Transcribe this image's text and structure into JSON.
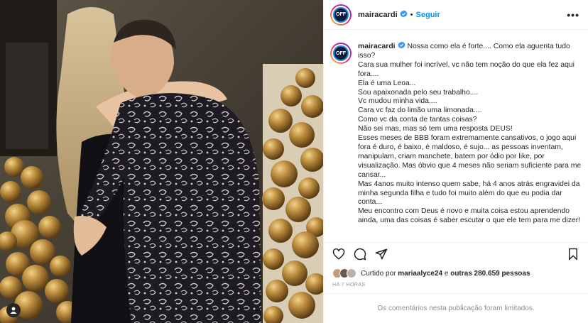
{
  "header": {
    "username": "mairacardi",
    "separator": "•",
    "follow_label": "Seguir",
    "more_label": "•••",
    "avatar_text": "OFF"
  },
  "caption": {
    "username": "mairacardi",
    "lines": [
      "Nossa como ela é forte.... Como ela aguenta tudo",
      "isso?",
      "Cara sua mulher foi incrível, vc não tem noção do que ela fez aqui",
      "fora....",
      "Ela é uma Leoa...",
      "Sou apaixonada pelo seu trabalho....",
      "Vc mudou minha vida....",
      "Cara vc faz do limão uma limonada....",
      "Como vc da conta de tantas coisas?",
      "Não sei mas, mas só tem uma resposta DEUS!",
      "Esses meses de BBB foram extremamente cansativos, o jogo aqui",
      "fora é duro, é baixo, é maldoso, é sujo... as pessoas inventam,",
      "manipulam, criam manchete, batem por ódio por like, por",
      "visualização. Mas óbvio que 4 meses não seriam suficiente para me",
      "cansar...",
      "Mas 4anos muito intenso quem sabe, há 4 anos atrás engravidei da",
      "minha segunda filha e tudo foi muito além do que eu podia dar",
      "conta...",
      "Meu encontro com Deus é novo e muita coisa estou aprendendo",
      "ainda, uma das coisas é saber escutar o que ele tem para me dizer!"
    ]
  },
  "likes": {
    "prefix": "Curtido por",
    "user": "mariaalyce24",
    "conjunction": "e",
    "others": "outras 280.659 pessoas"
  },
  "timestamp": "HÁ 7 HORAS",
  "comments_limited": "Os comentários nesta publicação foram limitados.",
  "colors": {
    "follow": "#0095f6",
    "text": "#262626",
    "muted": "#8e8e8e"
  },
  "icons": [
    "heart-icon",
    "comment-icon",
    "share-icon",
    "bookmark-icon",
    "verified-icon",
    "more-icon",
    "user-tag-icon"
  ]
}
